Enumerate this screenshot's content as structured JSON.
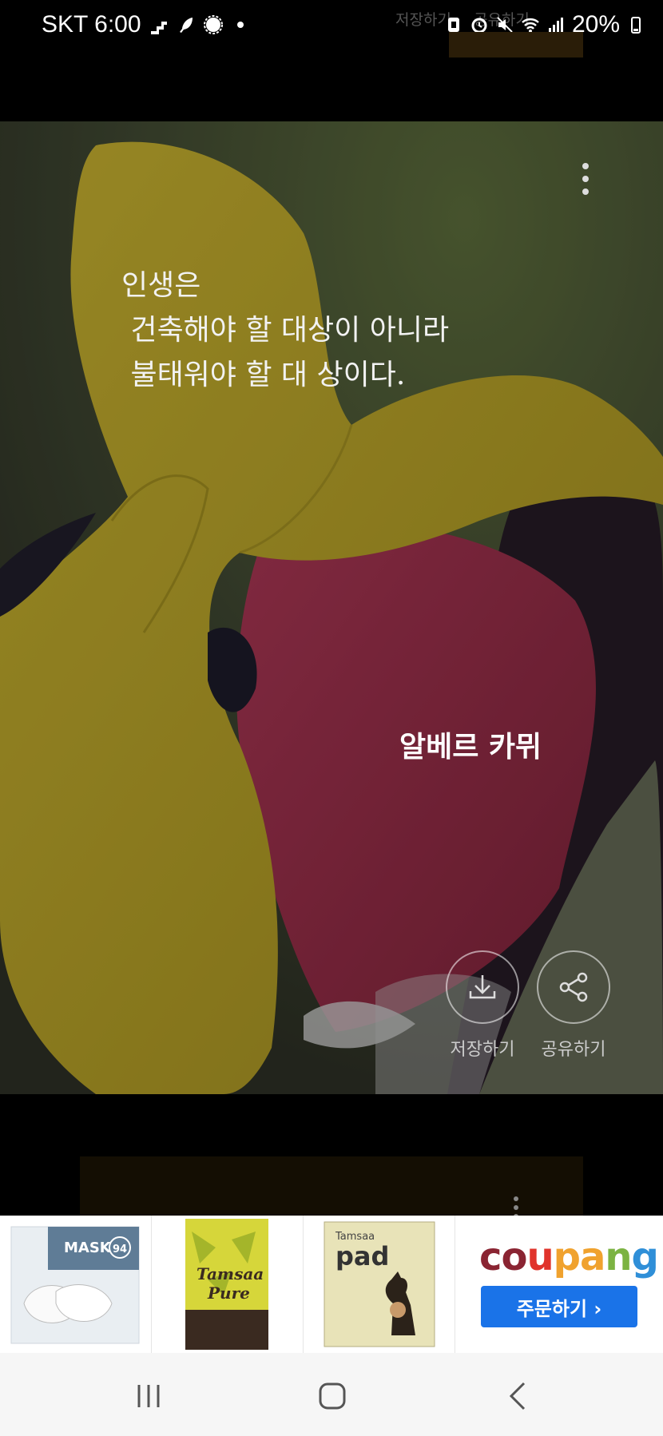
{
  "status_bar": {
    "carrier_time": "SKT 6:00",
    "battery_percent": "20%",
    "ghost_text": [
      "저장하기",
      "공유하기"
    ]
  },
  "quote": {
    "lines": "인생은\n 건축해야 할 대상이 아니라\n 불태워야 할 대 상이다.",
    "author": "알베르 카뮈"
  },
  "actions": {
    "save_label": "저장하기",
    "share_label": "공유하기"
  },
  "ad": {
    "products": [
      {
        "name": "Tamsaa MASK 94",
        "icon": "mask-box-icon"
      },
      {
        "name": "Tamsaa Pure",
        "icon": "tissue-box-icon"
      },
      {
        "name": "Tamsaa pad",
        "icon": "pet-pad-icon"
      }
    ],
    "brand_logo": "coupang",
    "order_button": "주문하기 ›",
    "logo_colors": [
      "#8a2432",
      "#e0332b",
      "#f0a22e",
      "#7cb342",
      "#2f8fd8"
    ]
  },
  "nav": {
    "recent_icon": "recent-apps-icon",
    "home_icon": "home-icon",
    "back_icon": "back-icon"
  },
  "colors": {
    "coupang_button": "#1a73e8"
  }
}
